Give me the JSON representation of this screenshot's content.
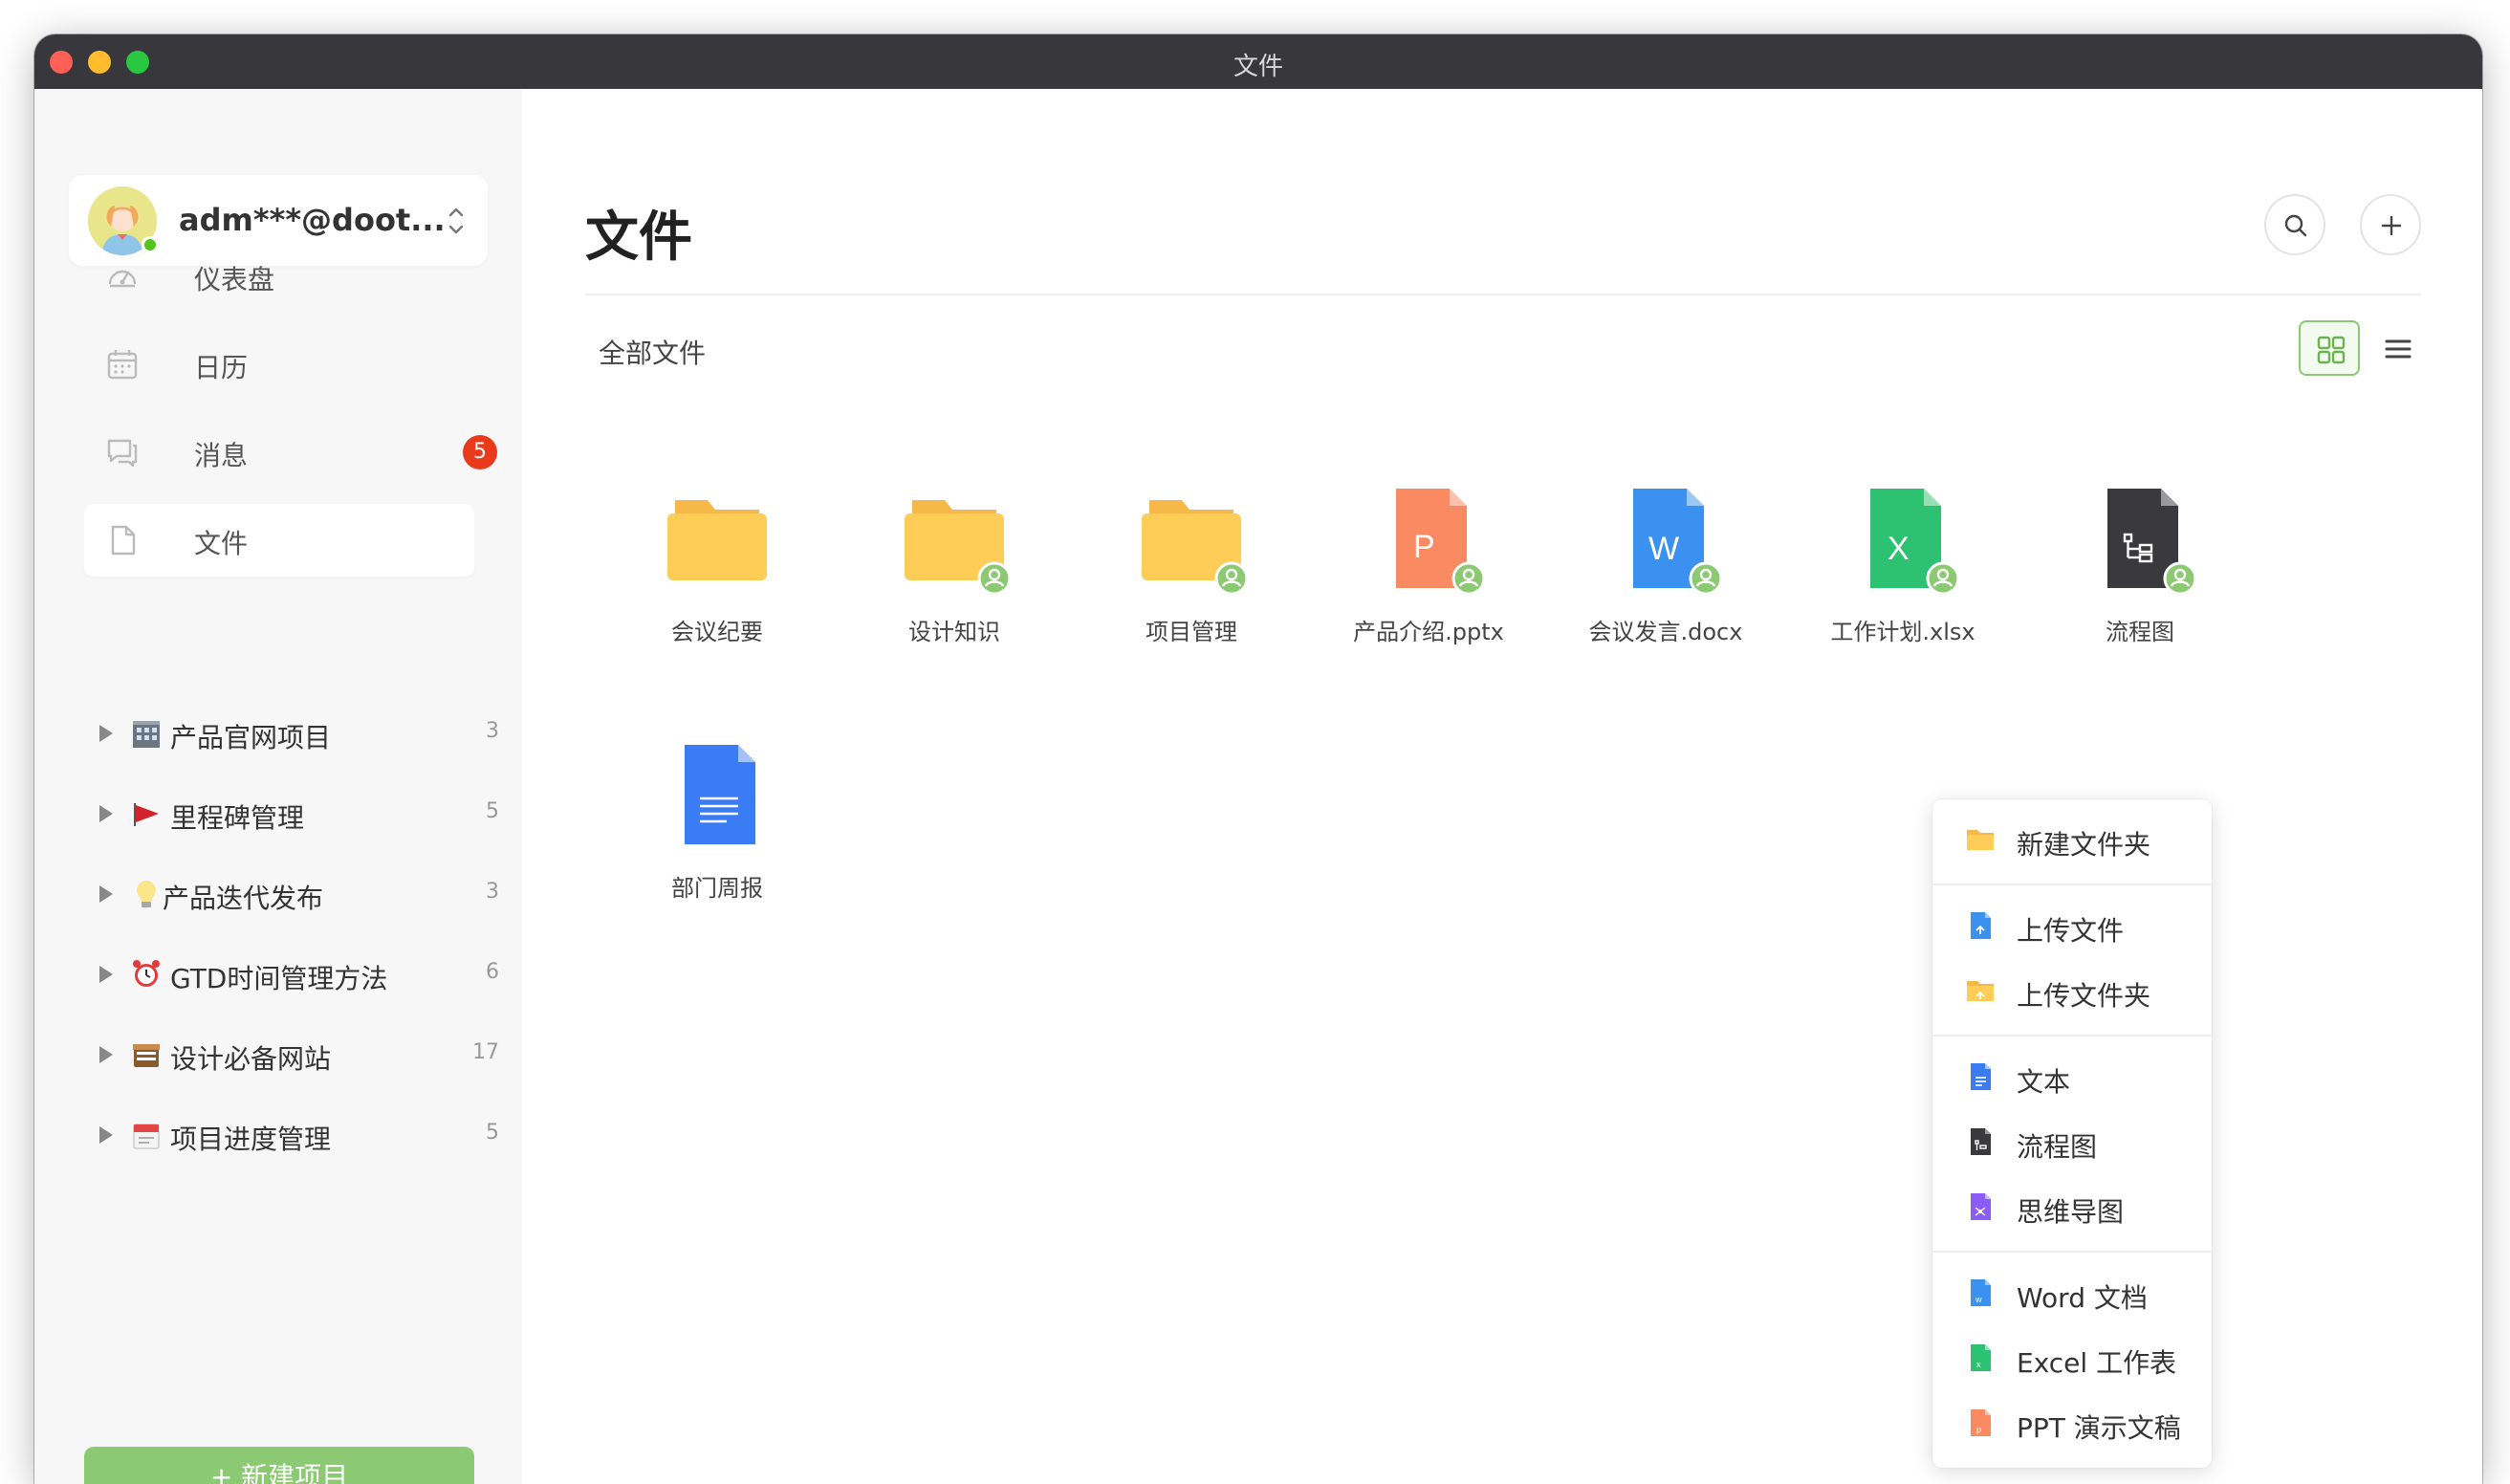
{
  "window": {
    "title": "文件"
  },
  "user": {
    "name": "adm***@doot..."
  },
  "nav": [
    {
      "id": "dashboard",
      "label": "仪表盘",
      "icon": "dashboard-icon"
    },
    {
      "id": "calendar",
      "label": "日历",
      "icon": "calendar-icon"
    },
    {
      "id": "messages",
      "label": "消息",
      "icon": "message-icon",
      "badge": "5"
    },
    {
      "id": "files",
      "label": "文件",
      "icon": "file-icon",
      "active": true
    }
  ],
  "projects": [
    {
      "emoji": "building-icon",
      "label": "产品官网项目",
      "count": "3"
    },
    {
      "emoji": "red-flag-icon",
      "label": "里程碑管理",
      "count": "5"
    },
    {
      "emoji": "lightbulb-icon",
      "label": "产品迭代发布",
      "count": "3"
    },
    {
      "emoji": "alarm-clock-icon",
      "label": "GTD时间管理方法",
      "count": "6"
    },
    {
      "emoji": "archive-box-icon",
      "label": "设计必备网站",
      "count": "17"
    },
    {
      "emoji": "calendar-page-icon",
      "label": "项目进度管理",
      "count": "5"
    }
  ],
  "sidebar_footer": {
    "new_project_label": "+ 新建项目"
  },
  "main": {
    "title": "文件",
    "breadcrumb": "全部文件"
  },
  "files": [
    {
      "name": "会议纪要",
      "type": "folder",
      "shared": false
    },
    {
      "name": "设计知识",
      "type": "folder",
      "shared": true
    },
    {
      "name": "项目管理",
      "type": "folder",
      "shared": true
    },
    {
      "name": "产品介绍.pptx",
      "type": "ppt",
      "letter": "P",
      "shared": true
    },
    {
      "name": "会议发言.docx",
      "type": "word",
      "letter": "W",
      "shared": true
    },
    {
      "name": "工作计划.xlsx",
      "type": "excel",
      "letter": "X",
      "shared": true
    },
    {
      "name": "流程图",
      "type": "flow",
      "shared": true
    },
    {
      "name": "部门周报",
      "type": "doc",
      "shared": false
    }
  ],
  "context_menu": {
    "new_folder": "新建文件夹",
    "upload_file": "上传文件",
    "upload_folder": "上传文件夹",
    "text": "文本",
    "flowchart": "流程图",
    "mindmap": "思维导图",
    "word": "Word 文档",
    "excel": "Excel 工作表",
    "ppt": "PPT 演示文稿"
  },
  "colors": {
    "accent": "#8cc973",
    "folder": "#fdcd58",
    "ppt": "#f98a62",
    "word": "#3b91f0",
    "excel": "#2dc172",
    "flow": "#3a3a3c",
    "doc": "#3a7cf3",
    "badge": "#ea3a1c"
  }
}
